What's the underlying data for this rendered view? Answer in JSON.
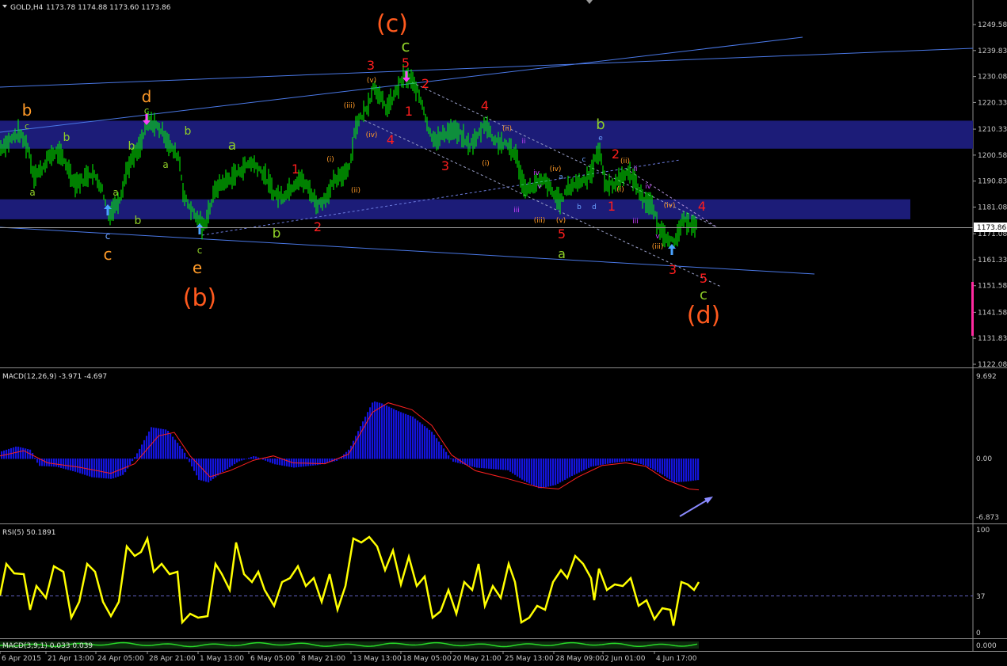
{
  "header": {
    "symbol": "GOLD,H4",
    "ohlc": "1173.78 1174.88 1173.60 1173.86"
  },
  "current_price_tag": "1173.86",
  "price_axis_ticks": [
    "1249.58",
    "1239.83",
    "1230.08",
    "1220.33",
    "1210.33",
    "1200.58",
    "1190.83",
    "1181.08",
    "1171.08",
    "1161.33",
    "1151.58",
    "1141.58",
    "1131.83",
    "1122.08"
  ],
  "time_axis_ticks": [
    "6 Apr 2015",
    "21 Apr 13:00",
    "24 Apr 05:00",
    "28 Apr 21:00",
    "1 May 13:00",
    "6 May 05:00",
    "8 May 21:00",
    "13 May 13:00",
    "18 May 05:00",
    "20 May 21:00",
    "25 May 13:00",
    "28 May 09:00",
    "2 Jun 01:00",
    "4 Jun 17:00"
  ],
  "macd_panel": {
    "title": "MACD(12,26,9) -3.971 -4.697",
    "ticks": [
      "9.692",
      "0.00",
      "-6.873"
    ]
  },
  "rsi_panel": {
    "title": "RSI(5) 50.1891",
    "ticks": [
      "100",
      "37",
      "0"
    ]
  },
  "bottom_panel": {
    "title": "MACD(3,9,1) 0.033 0.039",
    "ticks": [
      "0.000"
    ]
  },
  "colors": {
    "background": "#000000",
    "candles": "#00ff00",
    "zones": "#1c1c78",
    "trendlines": "#4a78e6",
    "histogram": "#1414dc",
    "macd_signal": "#ff2020",
    "rsi": "#ffff00",
    "major_wave_labels": "#ff5a1e",
    "red_labels": "#ff1e1e"
  },
  "wave_labels": [
    {
      "text": "(c)"
    },
    {
      "text": "c"
    },
    {
      "text": "3"
    },
    {
      "text": "5"
    },
    {
      "text": "(v)"
    },
    {
      "text": "2"
    },
    {
      "text": "1"
    },
    {
      "text": "(iii)"
    },
    {
      "text": "(iv)"
    },
    {
      "text": "4"
    },
    {
      "text": "4"
    },
    {
      "text": "3"
    },
    {
      "text": "(ii)"
    },
    {
      "text": "ii"
    },
    {
      "text": "(i)"
    },
    {
      "text": "iv"
    },
    {
      "text": "(iv)"
    },
    {
      "text": "iii"
    },
    {
      "text": "v"
    },
    {
      "text": "(iii)"
    },
    {
      "text": "(v)"
    },
    {
      "text": "5"
    },
    {
      "text": "a"
    },
    {
      "text": "b"
    },
    {
      "text": "e"
    },
    {
      "text": "c"
    },
    {
      "text": "a"
    },
    {
      "text": "b"
    },
    {
      "text": "d"
    },
    {
      "text": "2"
    },
    {
      "text": "(ii)"
    },
    {
      "text": "ii"
    },
    {
      "text": "iv"
    },
    {
      "text": "(i)"
    },
    {
      "text": "1"
    },
    {
      "text": "iii"
    },
    {
      "text": "v"
    },
    {
      "text": "(iv)"
    },
    {
      "text": "4"
    },
    {
      "text": "(iii)"
    },
    {
      "text": "3"
    },
    {
      "text": "5"
    },
    {
      "text": "c"
    },
    {
      "text": "(d)"
    },
    {
      "text": "b"
    },
    {
      "text": "c"
    },
    {
      "text": "a"
    },
    {
      "text": "b"
    },
    {
      "text": "c"
    },
    {
      "text": "c"
    },
    {
      "text": "a"
    },
    {
      "text": "b"
    },
    {
      "text": "d"
    },
    {
      "text": "c"
    },
    {
      "text": "b"
    },
    {
      "text": "a"
    },
    {
      "text": "a"
    },
    {
      "text": "b"
    },
    {
      "text": "c"
    },
    {
      "text": "e"
    },
    {
      "text": "(b)"
    },
    {
      "text": "1"
    },
    {
      "text": "2"
    },
    {
      "text": "(i)"
    },
    {
      "text": "(ii)"
    },
    {
      "text": "b"
    }
  ],
  "chart_data": {
    "type": "line",
    "title": "GOLD,H4",
    "price_range": [
      1122.08,
      1249.58
    ],
    "resistance_zones": [
      [
        1203.0,
        1213.5
      ],
      [
        1176.5,
        1184.0
      ]
    ],
    "price_path": [
      [
        0,
        1203
      ],
      [
        12,
        1206
      ],
      [
        24,
        1209
      ],
      [
        36,
        1203
      ],
      [
        42,
        1193
      ],
      [
        52,
        1195
      ],
      [
        62,
        1200
      ],
      [
        72,
        1202
      ],
      [
        84,
        1197
      ],
      [
        94,
        1190
      ],
      [
        104,
        1191
      ],
      [
        114,
        1194
      ],
      [
        122,
        1192
      ],
      [
        130,
        1187
      ],
      [
        136,
        1178
      ],
      [
        142,
        1180
      ],
      [
        152,
        1185
      ],
      [
        160,
        1195
      ],
      [
        168,
        1200
      ],
      [
        176,
        1203
      ],
      [
        186,
        1213
      ],
      [
        196,
        1212
      ],
      [
        206,
        1209
      ],
      [
        216,
        1203
      ],
      [
        226,
        1200
      ],
      [
        232,
        1185
      ],
      [
        240,
        1181
      ],
      [
        248,
        1177
      ],
      [
        256,
        1173
      ],
      [
        264,
        1180
      ],
      [
        272,
        1188
      ],
      [
        280,
        1190
      ],
      [
        292,
        1192
      ],
      [
        304,
        1195
      ],
      [
        316,
        1198
      ],
      [
        326,
        1196
      ],
      [
        336,
        1192
      ],
      [
        346,
        1186
      ],
      [
        356,
        1185
      ],
      [
        366,
        1188
      ],
      [
        378,
        1192
      ],
      [
        390,
        1188
      ],
      [
        400,
        1182
      ],
      [
        410,
        1184
      ],
      [
        420,
        1190
      ],
      [
        432,
        1193
      ],
      [
        442,
        1197
      ],
      [
        448,
        1211
      ],
      [
        456,
        1215
      ],
      [
        464,
        1219
      ],
      [
        472,
        1227
      ],
      [
        480,
        1222
      ],
      [
        488,
        1218
      ],
      [
        496,
        1222
      ],
      [
        504,
        1227
      ],
      [
        510,
        1230
      ],
      [
        518,
        1229
      ],
      [
        526,
        1225
      ],
      [
        534,
        1219
      ],
      [
        542,
        1209
      ],
      [
        552,
        1206
      ],
      [
        562,
        1209
      ],
      [
        572,
        1210
      ],
      [
        582,
        1208
      ],
      [
        592,
        1204
      ],
      [
        602,
        1207
      ],
      [
        612,
        1213
      ],
      [
        622,
        1207
      ],
      [
        632,
        1205
      ],
      [
        642,
        1204
      ],
      [
        652,
        1200
      ],
      [
        660,
        1189
      ],
      [
        668,
        1188
      ],
      [
        678,
        1190
      ],
      [
        688,
        1191
      ],
      [
        698,
        1186
      ],
      [
        708,
        1183
      ],
      [
        716,
        1188
      ],
      [
        726,
        1190
      ],
      [
        736,
        1191
      ],
      [
        746,
        1194
      ],
      [
        756,
        1203
      ],
      [
        764,
        1190
      ],
      [
        772,
        1189
      ],
      [
        780,
        1191
      ],
      [
        790,
        1194
      ],
      [
        800,
        1192
      ],
      [
        808,
        1186
      ],
      [
        816,
        1183
      ],
      [
        824,
        1181
      ],
      [
        830,
        1174
      ],
      [
        838,
        1171
      ],
      [
        846,
        1169
      ],
      [
        852,
        1167
      ],
      [
        860,
        1175
      ],
      [
        868,
        1176
      ],
      [
        876,
        1174
      ],
      [
        882,
        1174
      ]
    ],
    "macd_histogram_range": [
      -6.873,
      9.692
    ],
    "rsi_range": [
      0,
      100
    ],
    "rsi_level": 37
  }
}
